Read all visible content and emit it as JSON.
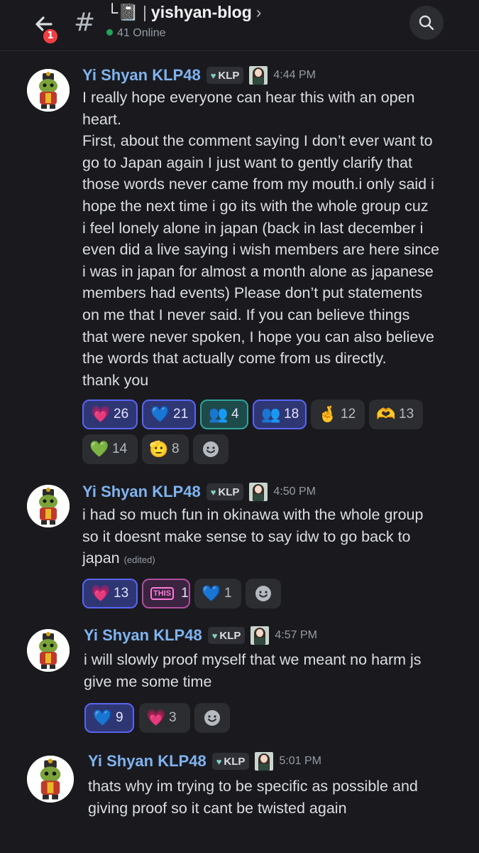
{
  "header": {
    "channel_prefix": "└📓",
    "channel_name": "yishyan-blog",
    "online_text": "41 Online",
    "unread_count": "1",
    "icons": [
      "back-arrow-icon",
      "hash-icon",
      "search-icon"
    ]
  },
  "messages": [
    {
      "author": "Yi Shyan KLP48",
      "tag": "KLP",
      "time": "4:44 PM",
      "text": "I really hope everyone can hear this with an open\nheart.\nFirst, about the comment saying I don’t ever want to\ngo to Japan again I just want to gently clarify that\nthose words never came from my mouth.i only said i\nhope the next time i go its with the whole group cuz\ni feel lonely alone in japan (back in last december i\neven did a live saying i wish members are here since\ni was in japan for almost a month alone as japanese\nmembers had events) Please don’t put statements\non me that I never said. If you can believe things\nthat were never spoken, I hope you can also believe\nthe words that actually come from us directly.\nthank you",
      "reactions": [
        {
          "emoji": "💗",
          "count": "26"
        },
        {
          "emoji": "💙",
          "count": "21"
        },
        {
          "emoji": "👥",
          "count": "4"
        },
        {
          "emoji": "👥",
          "count": "18"
        },
        {
          "emoji": "🤞",
          "count": "12"
        },
        {
          "emoji": "🫶",
          "count": "13"
        },
        {
          "emoji": "💚",
          "count": "14"
        },
        {
          "emoji": "🫡",
          "count": "8"
        }
      ]
    },
    {
      "author": "Yi Shyan KLP48",
      "tag": "KLP",
      "time": "4:50 PM",
      "text": "i had so much fun in okinawa with the whole group\nso it doesnt make sense to say idw to go back to\njapan",
      "edited": "(edited)",
      "reactions": [
        {
          "emoji": "💗",
          "count": "13"
        },
        {
          "emoji": "THIS",
          "count": "1"
        },
        {
          "emoji": "💙",
          "count": "1"
        }
      ]
    },
    {
      "author": "Yi Shyan KLP48",
      "tag": "KLP",
      "time": "4:57 PM",
      "text": "i will slowly proof myself that we meant no harm js\ngive me some time",
      "reactions": [
        {
          "emoji": "💙",
          "count": "9"
        },
        {
          "emoji": "💗",
          "count": "3"
        }
      ]
    },
    {
      "author": "Yi Shyan KLP48",
      "tag": "KLP",
      "time": "5:01 PM",
      "text": "thats why im trying to be specific as possible and\ngiving proof so it cant be twisted again"
    }
  ]
}
